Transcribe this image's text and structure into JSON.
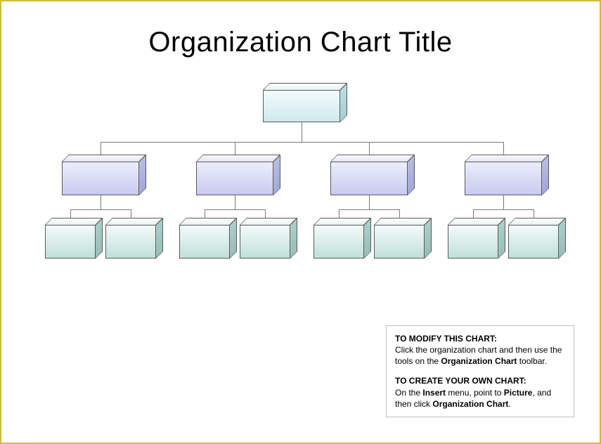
{
  "title": "Organization Chart Title",
  "help": {
    "section1_heading": "TO MODIFY THIS CHART:",
    "section1_line1": "Click the organization chart and then use the tools on the ",
    "section1_bold": "Organization Chart",
    "section1_line2": " toolbar.",
    "section2_heading": "TO CREATE YOUR OWN CHART:",
    "section2_a": "On the ",
    "section2_b": "Insert",
    "section2_c": " menu, point to ",
    "section2_d": "Picture",
    "section2_e": ", and then click ",
    "section2_f": "Organization Chart",
    "section2_g": "."
  },
  "org": {
    "level1": {
      "count": 1,
      "color": "blue"
    },
    "level2": {
      "count": 4,
      "color": "purple"
    },
    "level3": {
      "count_per_parent": 2,
      "color": "teal"
    }
  }
}
